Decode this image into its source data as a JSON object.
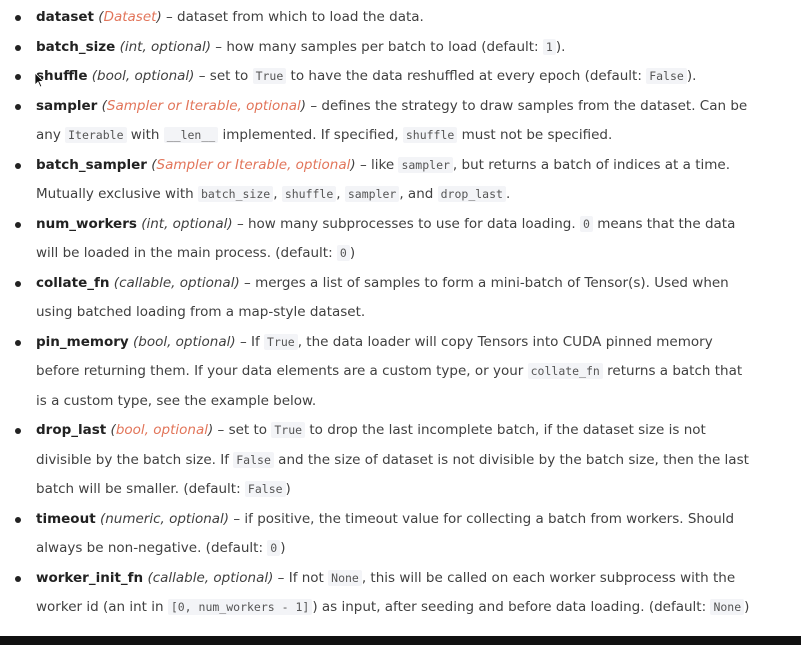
{
  "params": [
    {
      "parts": [
        {
          "k": "name",
          "t": "dataset"
        },
        {
          "k": "type",
          "t": "("
        },
        {
          "k": "xref",
          "t": "Dataset"
        },
        {
          "k": "type",
          "t": ")"
        },
        {
          "k": "text",
          "t": " – dataset from which to load the data."
        }
      ]
    },
    {
      "parts": [
        {
          "k": "name",
          "t": "batch_size"
        },
        {
          "k": "type",
          "t": "(int, optional)"
        },
        {
          "k": "text",
          "t": " – how many samples per batch to load (default: "
        },
        {
          "k": "code",
          "t": "1"
        },
        {
          "k": "text",
          "t": ")."
        }
      ]
    },
    {
      "parts": [
        {
          "k": "name",
          "t": "shuffle"
        },
        {
          "k": "type",
          "t": "(bool, optional)"
        },
        {
          "k": "text",
          "t": " – set to "
        },
        {
          "k": "code",
          "t": "True"
        },
        {
          "k": "text",
          "t": " to have the data reshuffled at every epoch (default: "
        },
        {
          "k": "code",
          "t": "False"
        },
        {
          "k": "text",
          "t": ")."
        }
      ]
    },
    {
      "parts": [
        {
          "k": "name",
          "t": "sampler"
        },
        {
          "k": "type",
          "t": "("
        },
        {
          "k": "xref",
          "t": "Sampler or Iterable, optional"
        },
        {
          "k": "type",
          "t": ")"
        },
        {
          "k": "text",
          "t": " – defines the strategy to draw samples from the dataset. Can be any "
        },
        {
          "k": "code",
          "t": "Iterable"
        },
        {
          "k": "text",
          "t": " with "
        },
        {
          "k": "code",
          "t": "__len__"
        },
        {
          "k": "text",
          "t": " implemented. If specified, "
        },
        {
          "k": "code",
          "t": "shuffle"
        },
        {
          "k": "text",
          "t": " must not be specified."
        }
      ]
    },
    {
      "parts": [
        {
          "k": "name",
          "t": "batch_sampler"
        },
        {
          "k": "type",
          "t": "("
        },
        {
          "k": "xref",
          "t": "Sampler or Iterable, optional"
        },
        {
          "k": "type",
          "t": ")"
        },
        {
          "k": "text",
          "t": " – like "
        },
        {
          "k": "code",
          "t": "sampler"
        },
        {
          "k": "text",
          "t": ", but returns a batch of indices at a time. Mutually exclusive with "
        },
        {
          "k": "code",
          "t": "batch_size"
        },
        {
          "k": "text",
          "t": ", "
        },
        {
          "k": "code",
          "t": "shuffle"
        },
        {
          "k": "text",
          "t": ", "
        },
        {
          "k": "code",
          "t": "sampler"
        },
        {
          "k": "text",
          "t": ", and "
        },
        {
          "k": "code",
          "t": "drop_last"
        },
        {
          "k": "text",
          "t": "."
        }
      ]
    },
    {
      "parts": [
        {
          "k": "name",
          "t": "num_workers"
        },
        {
          "k": "type",
          "t": "(int, optional)"
        },
        {
          "k": "text",
          "t": " – how many subprocesses to use for data loading. "
        },
        {
          "k": "code",
          "t": "0"
        },
        {
          "k": "text",
          "t": " means that the data will be loaded in the main process. (default: "
        },
        {
          "k": "code",
          "t": "0"
        },
        {
          "k": "text",
          "t": ")"
        }
      ]
    },
    {
      "parts": [
        {
          "k": "name",
          "t": "collate_fn"
        },
        {
          "k": "type",
          "t": "(callable, optional)"
        },
        {
          "k": "text",
          "t": " – merges a list of samples to form a mini-batch of Tensor(s). Used when using batched loading from a map-style dataset."
        }
      ]
    },
    {
      "parts": [
        {
          "k": "name",
          "t": "pin_memory"
        },
        {
          "k": "type",
          "t": "(bool, optional)"
        },
        {
          "k": "text",
          "t": " – If "
        },
        {
          "k": "code",
          "t": "True"
        },
        {
          "k": "text",
          "t": ", the data loader will copy Tensors into CUDA pinned memory before returning them. If your data elements are a custom type, or your "
        },
        {
          "k": "code",
          "t": "collate_fn"
        },
        {
          "k": "text",
          "t": " returns a batch that is a custom type, see the example below."
        }
      ]
    },
    {
      "parts": [
        {
          "k": "name",
          "t": "drop_last"
        },
        {
          "k": "type",
          "t": "("
        },
        {
          "k": "xref",
          "t": "bool, optional"
        },
        {
          "k": "type",
          "t": ")"
        },
        {
          "k": "text",
          "t": " – set to "
        },
        {
          "k": "code",
          "t": "True"
        },
        {
          "k": "text",
          "t": " to drop the last incomplete batch, if the dataset size is not divisible by the batch size. If "
        },
        {
          "k": "code",
          "t": "False"
        },
        {
          "k": "text",
          "t": " and the size of dataset is not divisible by the batch size, then the last batch will be smaller. (default: "
        },
        {
          "k": "code",
          "t": "False"
        },
        {
          "k": "text",
          "t": ")"
        }
      ]
    },
    {
      "parts": [
        {
          "k": "name",
          "t": "timeout"
        },
        {
          "k": "type",
          "t": "(numeric, optional)"
        },
        {
          "k": "text",
          "t": " – if positive, the timeout value for collecting a batch from workers. Should always be non-negative. (default: "
        },
        {
          "k": "code",
          "t": "0"
        },
        {
          "k": "text",
          "t": ")"
        }
      ]
    },
    {
      "parts": [
        {
          "k": "name",
          "t": "worker_init_fn"
        },
        {
          "k": "type",
          "t": "(callable, optional)"
        },
        {
          "k": "text",
          "t": " – If not "
        },
        {
          "k": "code",
          "t": "None"
        },
        {
          "k": "text",
          "t": ", this will be called on each worker subprocess with the worker id (an int in "
        },
        {
          "k": "code",
          "t": "[0, num_workers - 1]"
        },
        {
          "k": "text",
          "t": ") as input, after seeding and before data loading. (default: "
        },
        {
          "k": "code",
          "t": "None"
        },
        {
          "k": "text",
          "t": ")"
        }
      ]
    }
  ],
  "colors": {
    "text": "#404040",
    "param_name": "#222222",
    "xref_link": "#e2755a",
    "code_bg": "#f3f4f7",
    "bottom_bar": "#111111"
  },
  "cursor": {
    "icon": "mouse-pointer-icon"
  }
}
